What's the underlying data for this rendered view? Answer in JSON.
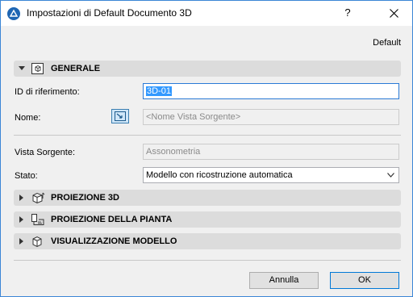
{
  "window": {
    "title": "Impostazioni di Default Documento 3D",
    "help_label": "?"
  },
  "header": {
    "default_label": "Default"
  },
  "sections": [
    {
      "label": "GENERALE",
      "expanded": true,
      "icon": "document-3d-icon"
    },
    {
      "label": "PROIEZIONE 3D",
      "expanded": false,
      "icon": "projection-3d-icon"
    },
    {
      "label": "PROIEZIONE DELLA PIANTA",
      "expanded": false,
      "icon": "floor-plan-projection-icon"
    },
    {
      "label": "VISUALIZZAZIONE MODELLO",
      "expanded": false,
      "icon": "model-display-icon"
    }
  ],
  "general": {
    "ref_id_label": "ID di riferimento:",
    "ref_id_value": "3D-01",
    "name_label": "Nome:",
    "name_placeholder": "<Nome Vista Sorgente>",
    "source_view_label": "Vista Sorgente:",
    "source_view_value": "Assonometria",
    "state_label": "Stato:",
    "state_value": "Modello con ricostruzione automatica"
  },
  "buttons": {
    "cancel": "Annulla",
    "ok": "OK"
  },
  "colors": {
    "accent": "#0078d7",
    "selection": "#3399ff",
    "section_bg": "#dcdcdc"
  }
}
